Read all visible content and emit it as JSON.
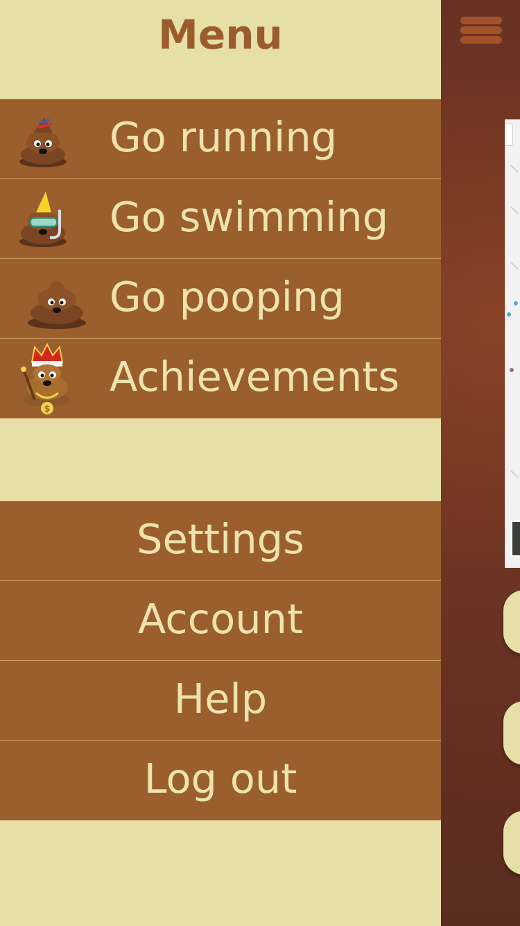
{
  "menu": {
    "title": "Menu",
    "primary_items": [
      {
        "label": "Go running",
        "icon": "running-poop-icon"
      },
      {
        "label": "Go swimming",
        "icon": "swimming-poop-icon"
      },
      {
        "label": "Go pooping",
        "icon": "poop-icon"
      },
      {
        "label": "Achievements",
        "icon": "king-poop-icon"
      }
    ],
    "secondary_items": [
      {
        "label": "Settings"
      },
      {
        "label": "Account"
      },
      {
        "label": "Help"
      },
      {
        "label": "Log out"
      }
    ]
  },
  "background_app": {
    "hamburger_icon": "hamburger-menu-icon",
    "map": "map-view"
  },
  "colors": {
    "drawer_background": "#e6dfa7",
    "menu_item_background": "#9b5e2d",
    "menu_item_text": "#ece3ad",
    "menu_title": "#9b5c2d",
    "app_background": "#6a3422"
  }
}
